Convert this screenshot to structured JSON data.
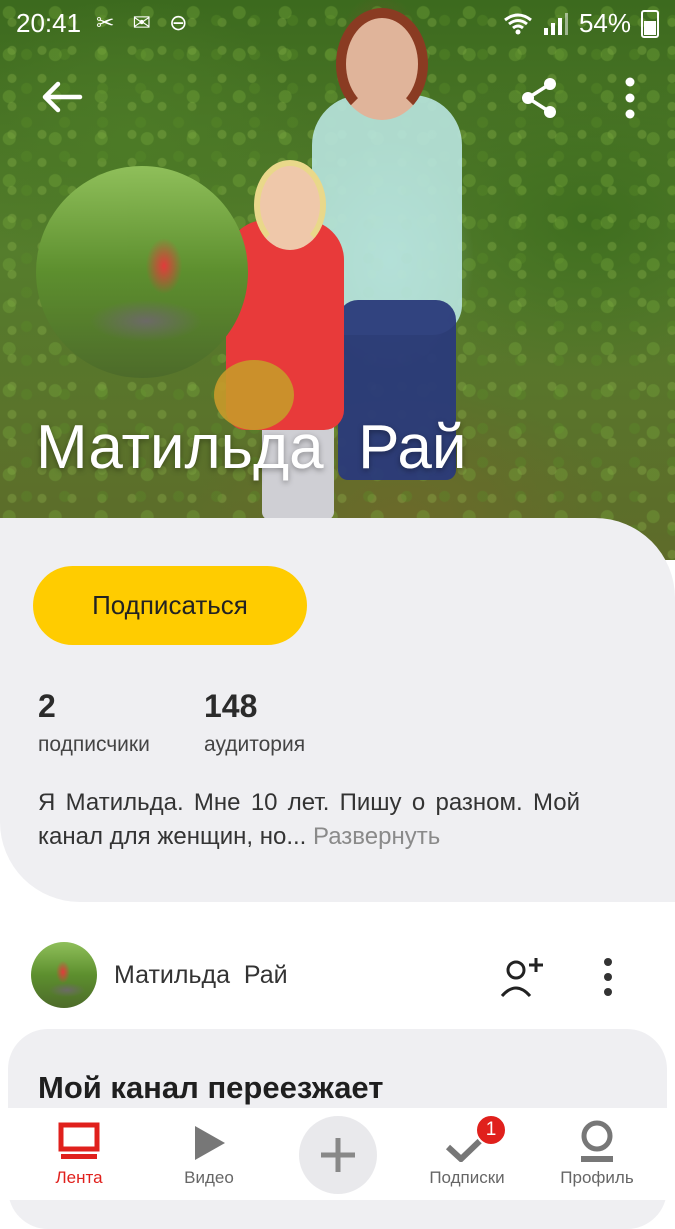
{
  "status_bar": {
    "time": "20:41",
    "left_icons": "✂ ✉ ⊖",
    "battery_percent": "54%"
  },
  "profile": {
    "name": "Матильда  Рай",
    "subscribe_label": "Подписаться",
    "stats": [
      {
        "value": "2",
        "label": "подписчики"
      },
      {
        "value": "148",
        "label": "аудитория"
      }
    ],
    "description": "Я Матильда.  Мне 10 лет. Пишу о разном. Мой канал  для женщин, но...",
    "expand_label": "Развернуть"
  },
  "feed": {
    "author_name": "Матильда  Рай",
    "post_title": "Мой канал переезжает"
  },
  "bottom_nav": {
    "tabs": [
      {
        "label": "Лента",
        "icon": "feed-icon",
        "active": true
      },
      {
        "label": "Видео",
        "icon": "play-icon"
      },
      {
        "label": "",
        "icon": "plus-icon"
      },
      {
        "label": "Подписки",
        "icon": "checkmark-icon",
        "badge": "1"
      },
      {
        "label": "Профиль",
        "icon": "profile-icon"
      }
    ]
  },
  "colors": {
    "accent_yellow": "#ffcc00",
    "active_red": "#e0201c",
    "card_bg": "#efeff2"
  }
}
